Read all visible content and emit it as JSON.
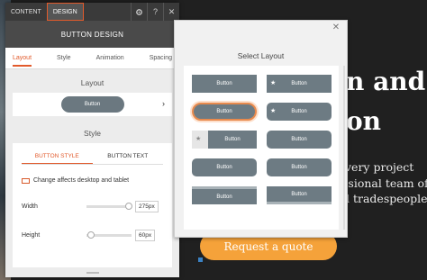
{
  "topbar": {
    "tabs": [
      "CONTENT",
      "DESIGN"
    ],
    "active_tab": "DESIGN",
    "icons": [
      "gear-icon",
      "help-icon",
      "close-icon"
    ],
    "help_label": "?",
    "close_label": "✕"
  },
  "panel": {
    "title": "BUTTON DESIGN",
    "subtabs": [
      "Layout",
      "Style",
      "Animation",
      "Spacing"
    ],
    "active_subtab": "Layout",
    "layout_heading": "Layout",
    "layout_preview_label": "Button",
    "style_heading": "Style",
    "style_tabs": [
      "BUTTON STYLE",
      "BUTTON TEXT"
    ],
    "active_style_tab": "BUTTON STYLE",
    "note": "Change affects desktop and tablet",
    "width": {
      "label": "Width",
      "value": "275px",
      "fraction": 0.85
    },
    "height": {
      "label": "Height",
      "value": "60px",
      "fraction": 0.05
    }
  },
  "popup": {
    "title": "Select Layout",
    "close_label": "✕",
    "options": [
      {
        "label": "Button"
      },
      {
        "label": "Button"
      },
      {
        "label": "Button"
      },
      {
        "label": "Button"
      },
      {
        "label": "Button"
      },
      {
        "label": "Button"
      },
      {
        "label": "Button"
      },
      {
        "label": "Button"
      },
      {
        "label": "Button"
      },
      {
        "label": "Button"
      }
    ]
  },
  "page": {
    "hero_lines": [
      "n and",
      "on"
    ],
    "body_lines": [
      "very project",
      "ssional team of",
      "d tradespeople."
    ],
    "cta_label": "Request a quote",
    "cta_close": "✕"
  },
  "colors": {
    "accent": "#e25a2b",
    "button_gray": "#6d7b83",
    "cta_orange": "#f5a23a"
  }
}
